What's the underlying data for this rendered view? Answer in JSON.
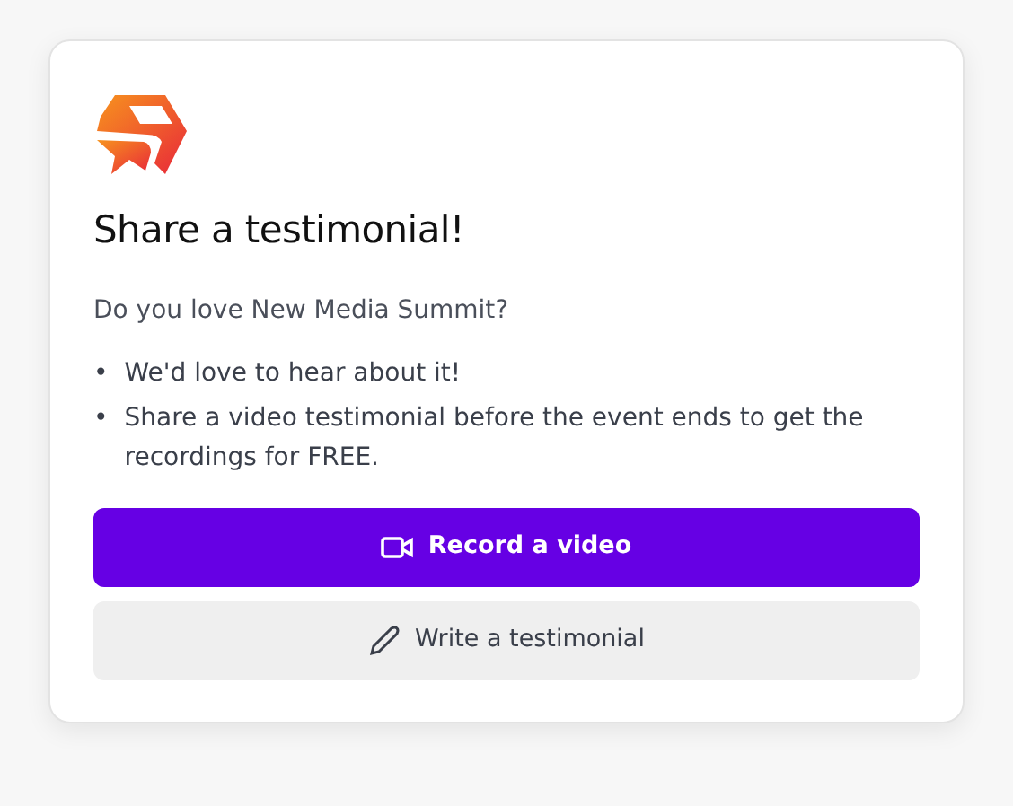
{
  "title": "Share a testimonial!",
  "question": "Do you love New Media Summit?",
  "points": [
    {
      "marker": "•",
      "text": "We'd love to hear about it!"
    },
    {
      "marker": "•",
      "text": "Share a video testimonial before the event ends to get the recordings for FREE."
    }
  ],
  "buttons": [
    {
      "label": "Record a video",
      "kind": "video"
    },
    {
      "label": "Write a testimonial",
      "kind": "text"
    }
  ]
}
